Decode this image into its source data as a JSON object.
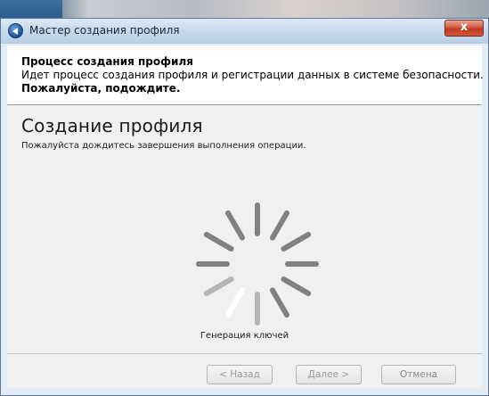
{
  "window": {
    "title": "Мастер создания профиля",
    "close_label": "x"
  },
  "header": {
    "title": "Процесс создания профиля",
    "description": "Идет процесс создания профиля и регистрации данных в системе безопасности.",
    "wait": "Пожалуйста, подождите."
  },
  "main": {
    "section_title": "Создание профиля",
    "section_subtitle": "Пожалуйста дождитесь завершения выполнения операции.",
    "status": "Генерация ключей"
  },
  "buttons": {
    "back": "< Назад",
    "next": "Далее >",
    "cancel": "Отмена"
  },
  "colors": {
    "spinner": "#6e6e6e",
    "spinner_active": "#ffffff"
  }
}
